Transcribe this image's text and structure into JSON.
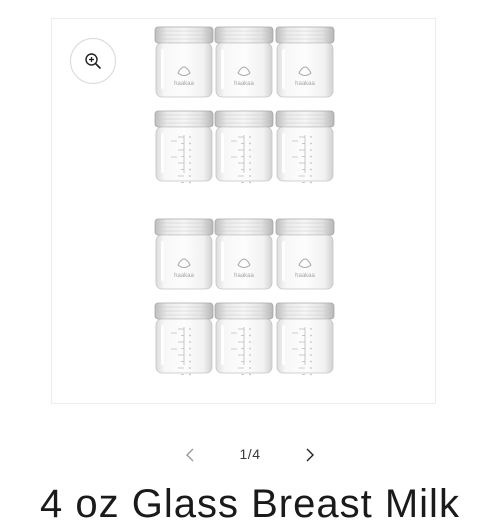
{
  "gallery": {
    "image_alt": "12 glass breast milk storage jars",
    "jar_brand": "haakaa",
    "zoom_icon": "zoom-in-icon",
    "pagination": {
      "prev_icon": "chevron-left-icon",
      "counter": "1/4",
      "next_icon": "chevron-right-icon"
    }
  },
  "product": {
    "title": "4 oz Glass Breast Milk"
  }
}
